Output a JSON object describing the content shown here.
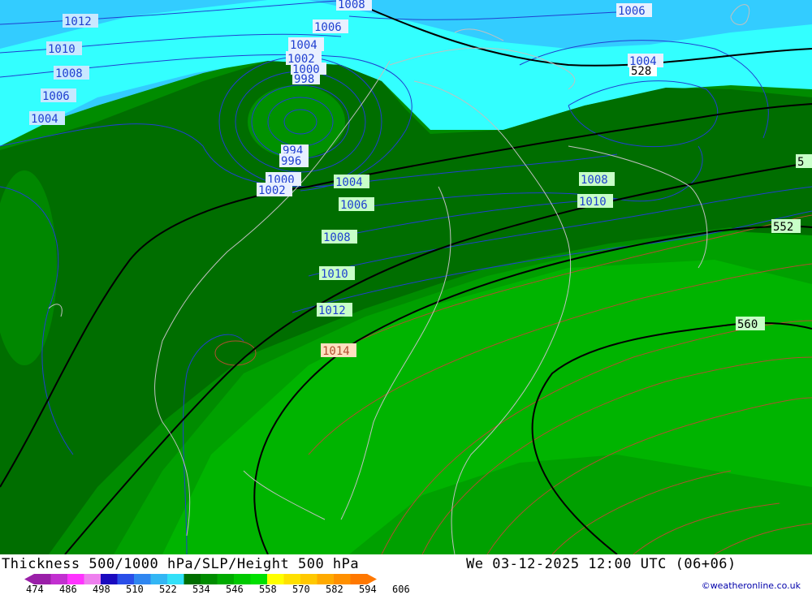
{
  "footer": {
    "title": "Thickness 500/1000 hPa/SLP/Height 500 hPa",
    "datetime": "We 03-12-2025 12:00 UTC (06+06)",
    "copyright": "©weatheronline.co.uk"
  },
  "legend": {
    "labels": [
      "474",
      "486",
      "498",
      "510",
      "522",
      "534",
      "546",
      "558",
      "570",
      "582",
      "594",
      "606"
    ],
    "colors": [
      "#9a1fa8",
      "#c22fd0",
      "#ff33ff",
      "#ee80ee",
      "#1a0abf",
      "#2a4ee8",
      "#2f86f0",
      "#33b6f4",
      "#33e0f8",
      "#006e00",
      "#008c00",
      "#00aa00",
      "#00c800",
      "#00e000",
      "#ffff00",
      "#ffe000",
      "#ffc800",
      "#ffaa00",
      "#ff9000",
      "#ff7800"
    ]
  },
  "map": {
    "fill_colors": {
      "light_cyan": "#33ffff",
      "sky": "#33ccff",
      "dark_green": "#006e00",
      "green": "#008c00",
      "mid_green": "#00a000",
      "bright_green": "#00b400"
    },
    "pressure_labels": [
      "1012",
      "1010",
      "1008",
      "1006",
      "1004",
      "1008",
      "1006",
      "1004",
      "1002",
      "1000",
      "998",
      "994",
      "996",
      "1000",
      "1002",
      "1004",
      "1006",
      "1008",
      "1010",
      "1012",
      "1014",
      "1008",
      "1010",
      "1006",
      "1004"
    ],
    "height_labels": [
      "528",
      "552",
      "560",
      "5"
    ]
  }
}
